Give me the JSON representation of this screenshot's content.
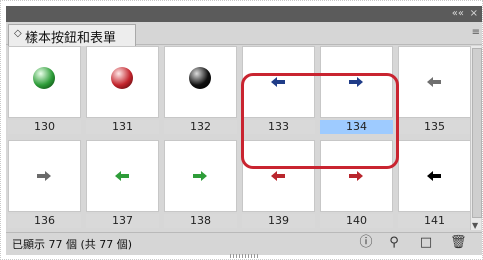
{
  "window": {
    "collapse_glyph": "««",
    "close_glyph": "×",
    "panel_title": "樣本按鈕和表單",
    "panel_menu_glyph": "≡"
  },
  "grid": {
    "items": [
      {
        "id": "130",
        "kind": "ball",
        "color": "#2e9d39"
      },
      {
        "id": "131",
        "kind": "ball",
        "color": "#c3252d"
      },
      {
        "id": "132",
        "kind": "ball",
        "color": "#111111"
      },
      {
        "id": "133",
        "kind": "arrow",
        "dir": "left",
        "color": "#1f3c88"
      },
      {
        "id": "134",
        "kind": "arrow",
        "dir": "right",
        "color": "#1f3c88",
        "selected": true
      },
      {
        "id": "135",
        "kind": "arrow",
        "dir": "left",
        "color": "#6f6f6f"
      },
      {
        "id": "136",
        "kind": "arrow",
        "dir": "right",
        "color": "#6a6a6a"
      },
      {
        "id": "137",
        "kind": "arrow",
        "dir": "left",
        "color": "#2e9d39"
      },
      {
        "id": "138",
        "kind": "arrow",
        "dir": "right",
        "color": "#2e9d39"
      },
      {
        "id": "139",
        "kind": "arrow",
        "dir": "left",
        "color": "#b9262d"
      },
      {
        "id": "140",
        "kind": "arrow",
        "dir": "right",
        "color": "#b9262d"
      },
      {
        "id": "141",
        "kind": "arrow",
        "dir": "left",
        "color": "#000000"
      }
    ]
  },
  "status": {
    "count_text": "已顯示 77 個 (共 77 個)"
  },
  "icons": {
    "info": "ⓘ",
    "search": "⚲",
    "new": "□",
    "delete": "🗑"
  },
  "scroll": {
    "down_glyph": "▼"
  },
  "colors": {
    "highlight": "#c92430",
    "selected_label": "#9ecbff"
  }
}
